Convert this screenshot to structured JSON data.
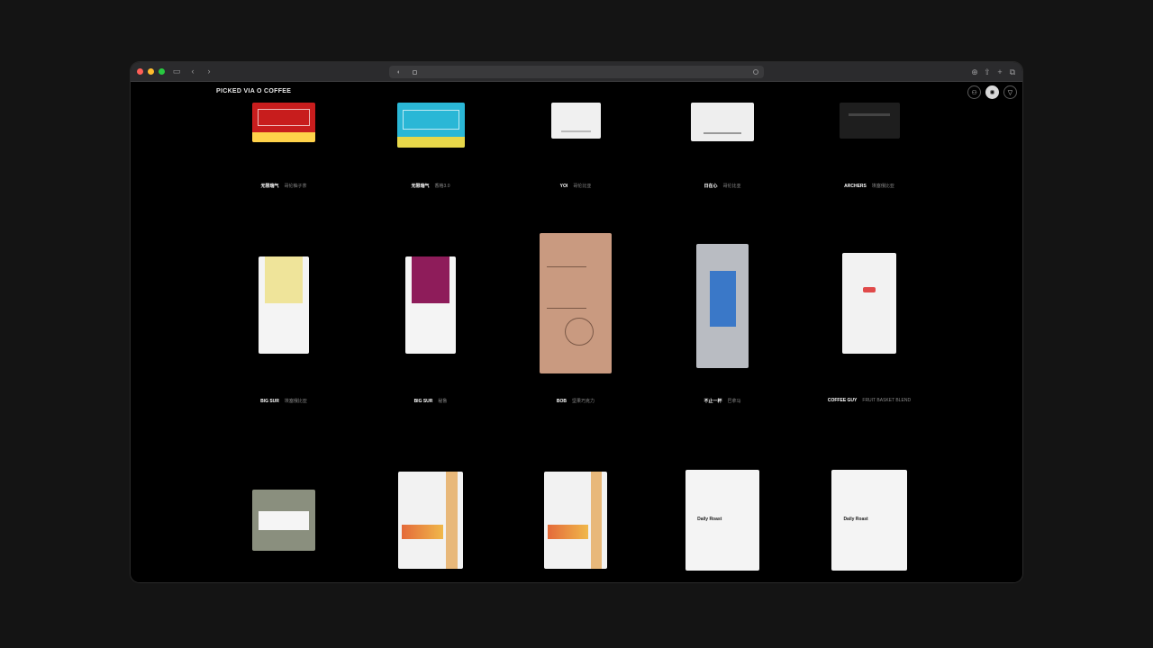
{
  "brand": "PICKED VIA O COFFEE",
  "toolbar": {
    "user_icon": "person-icon",
    "theme_icon": "sun-icon",
    "filter_icon": "filter-icon"
  },
  "colors": {
    "window_bg": "#000000",
    "chrome": "#2b2b2d"
  },
  "products": [
    {
      "brand": "无限瑞气",
      "name": "哥伦柚子茶",
      "meta": "",
      "bag_color": "#c81d1d",
      "bag_accent": "#ffd24a"
    },
    {
      "brand": "无限瑞气",
      "name": "香格3.0",
      "meta": "",
      "bag_color": "#2ab7d6",
      "bag_accent": "#e8d84a"
    },
    {
      "brand": "YOI",
      "name": "哥伦比亚",
      "meta": "",
      "bag_color": "#f0f0f0",
      "bag_accent": "#bbbbbb"
    },
    {
      "brand": "日在心",
      "name": "哥伦比亚",
      "meta": "",
      "bag_color": "#eeeeee",
      "bag_accent": "#999999"
    },
    {
      "brand": "ARCHERS",
      "name": "埃塞俄比亚",
      "meta": "",
      "bag_color": "#1e1e1e",
      "bag_accent": "#444444"
    },
    {
      "brand": "BIG SUR",
      "name": "埃塞俄比亚",
      "meta": "",
      "bag_color": "#f4f4f4",
      "bag_accent": "#efe49a"
    },
    {
      "brand": "BIG SUR",
      "name": "秘鲁",
      "meta": "",
      "bag_color": "#f4f4f4",
      "bag_accent": "#8e1c5a"
    },
    {
      "brand": "BOB",
      "name": "坚果巧克力",
      "meta": "",
      "bag_color": "#c99a80",
      "bag_accent": "#a77a62"
    },
    {
      "brand": "不止一杯",
      "name": "巴拿马",
      "meta": "",
      "bag_color": "#b9bcc2",
      "bag_accent": "#3a78c8"
    },
    {
      "brand": "COFFEE GUY",
      "name": "FRUIT BASKET BLEND",
      "meta": "",
      "bag_color": "#f2f2f2",
      "bag_accent": "#e04a4a"
    },
    {
      "brand": "",
      "name": "",
      "meta": "",
      "bag_color": "#8a8f7e",
      "bag_accent": "#ffffff"
    },
    {
      "brand": "",
      "name": "",
      "meta": "",
      "bag_color": "#f2f2f2",
      "bag_accent": "#e8b87a"
    },
    {
      "brand": "",
      "name": "",
      "meta": "",
      "bag_color": "#f2f2f2",
      "bag_accent": "#e8b87a"
    },
    {
      "brand": "",
      "name": "",
      "meta": "",
      "bag_color": "#f4f4f4",
      "bag_accent": "Daily Roast"
    },
    {
      "brand": "",
      "name": "",
      "meta": "",
      "bag_color": "#f4f4f4",
      "bag_accent": "Daily Roast"
    }
  ]
}
